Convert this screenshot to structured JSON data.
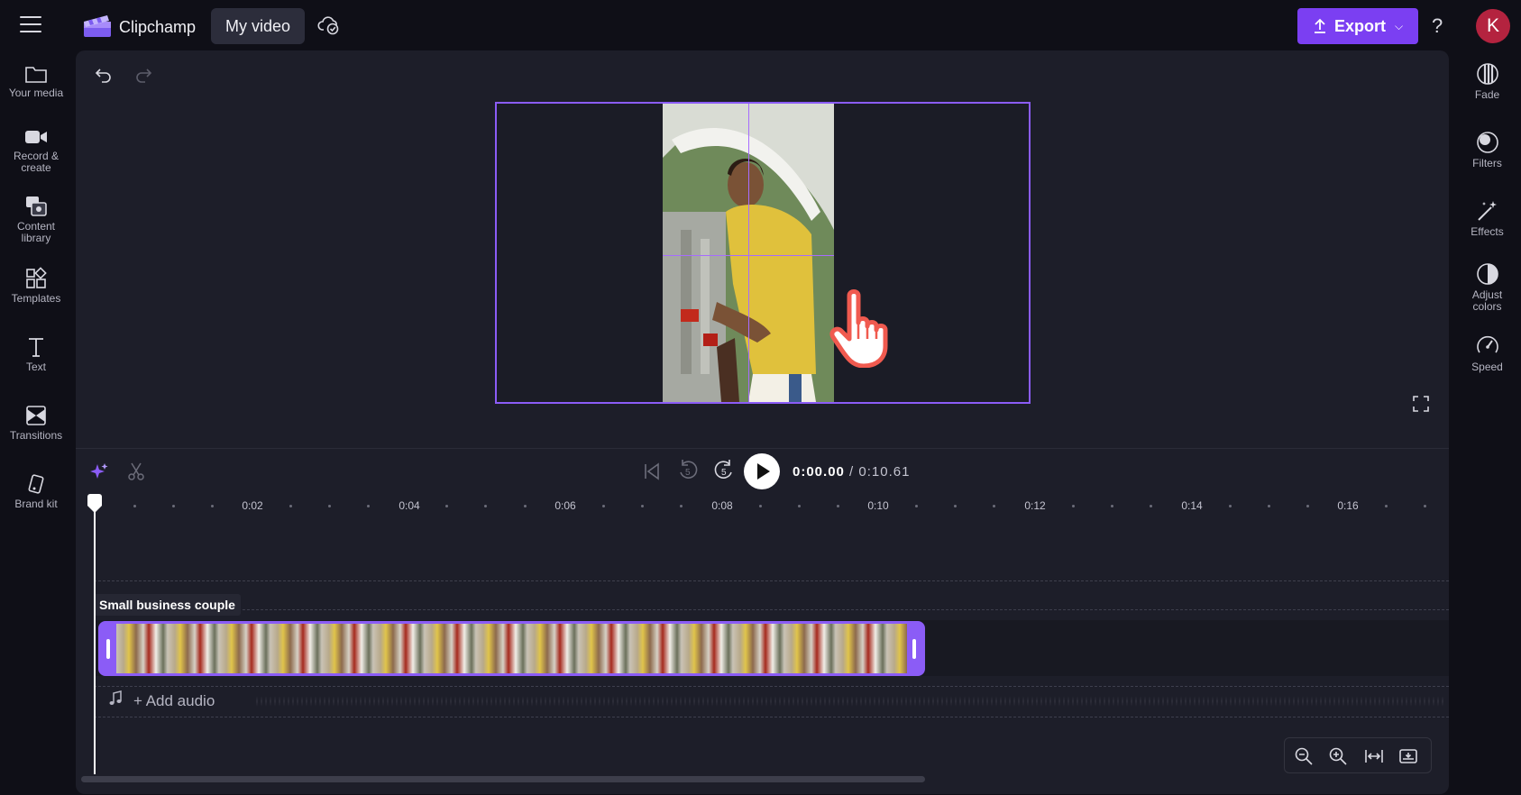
{
  "topbar": {
    "app_title": "Clipchamp",
    "project_name": "My video",
    "export_label": "Export",
    "help_label": "?",
    "avatar_initial": "K"
  },
  "left_sidebar": {
    "items": [
      {
        "label": "Your media",
        "icon": "folder-icon"
      },
      {
        "label": "Record & create",
        "icon": "camera-icon"
      },
      {
        "label": "Content library",
        "icon": "library-icon"
      },
      {
        "label": "Templates",
        "icon": "templates-icon"
      },
      {
        "label": "Text",
        "icon": "text-icon"
      },
      {
        "label": "Transitions",
        "icon": "transitions-icon"
      },
      {
        "label": "Brand kit",
        "icon": "brand-kit-icon"
      }
    ]
  },
  "right_sidebar": {
    "items": [
      {
        "label": "Fade",
        "icon": "fade-icon"
      },
      {
        "label": "Filters",
        "icon": "filters-icon"
      },
      {
        "label": "Effects",
        "icon": "effects-icon"
      },
      {
        "label": "Adjust colors",
        "icon": "adjust-colors-icon"
      },
      {
        "label": "Speed",
        "icon": "speed-icon"
      }
    ]
  },
  "playback": {
    "current_time": "0:00.00",
    "separator": "/",
    "total_time": "0:10.61",
    "rewind_seconds": "5",
    "forward_seconds": "5"
  },
  "timeline": {
    "ruler_labels": [
      "0:02",
      "0:04",
      "0:06",
      "0:08",
      "0:10",
      "0:12",
      "0:14",
      "0:16"
    ],
    "clip_name": "Small business couple",
    "add_audio_label": "+ Add audio"
  },
  "colors": {
    "accent": "#7b3ff2",
    "clip_border": "#8b5cf6",
    "avatar_bg": "#b4233f",
    "background": "#0f0f17",
    "panel": "#1d1e29"
  }
}
